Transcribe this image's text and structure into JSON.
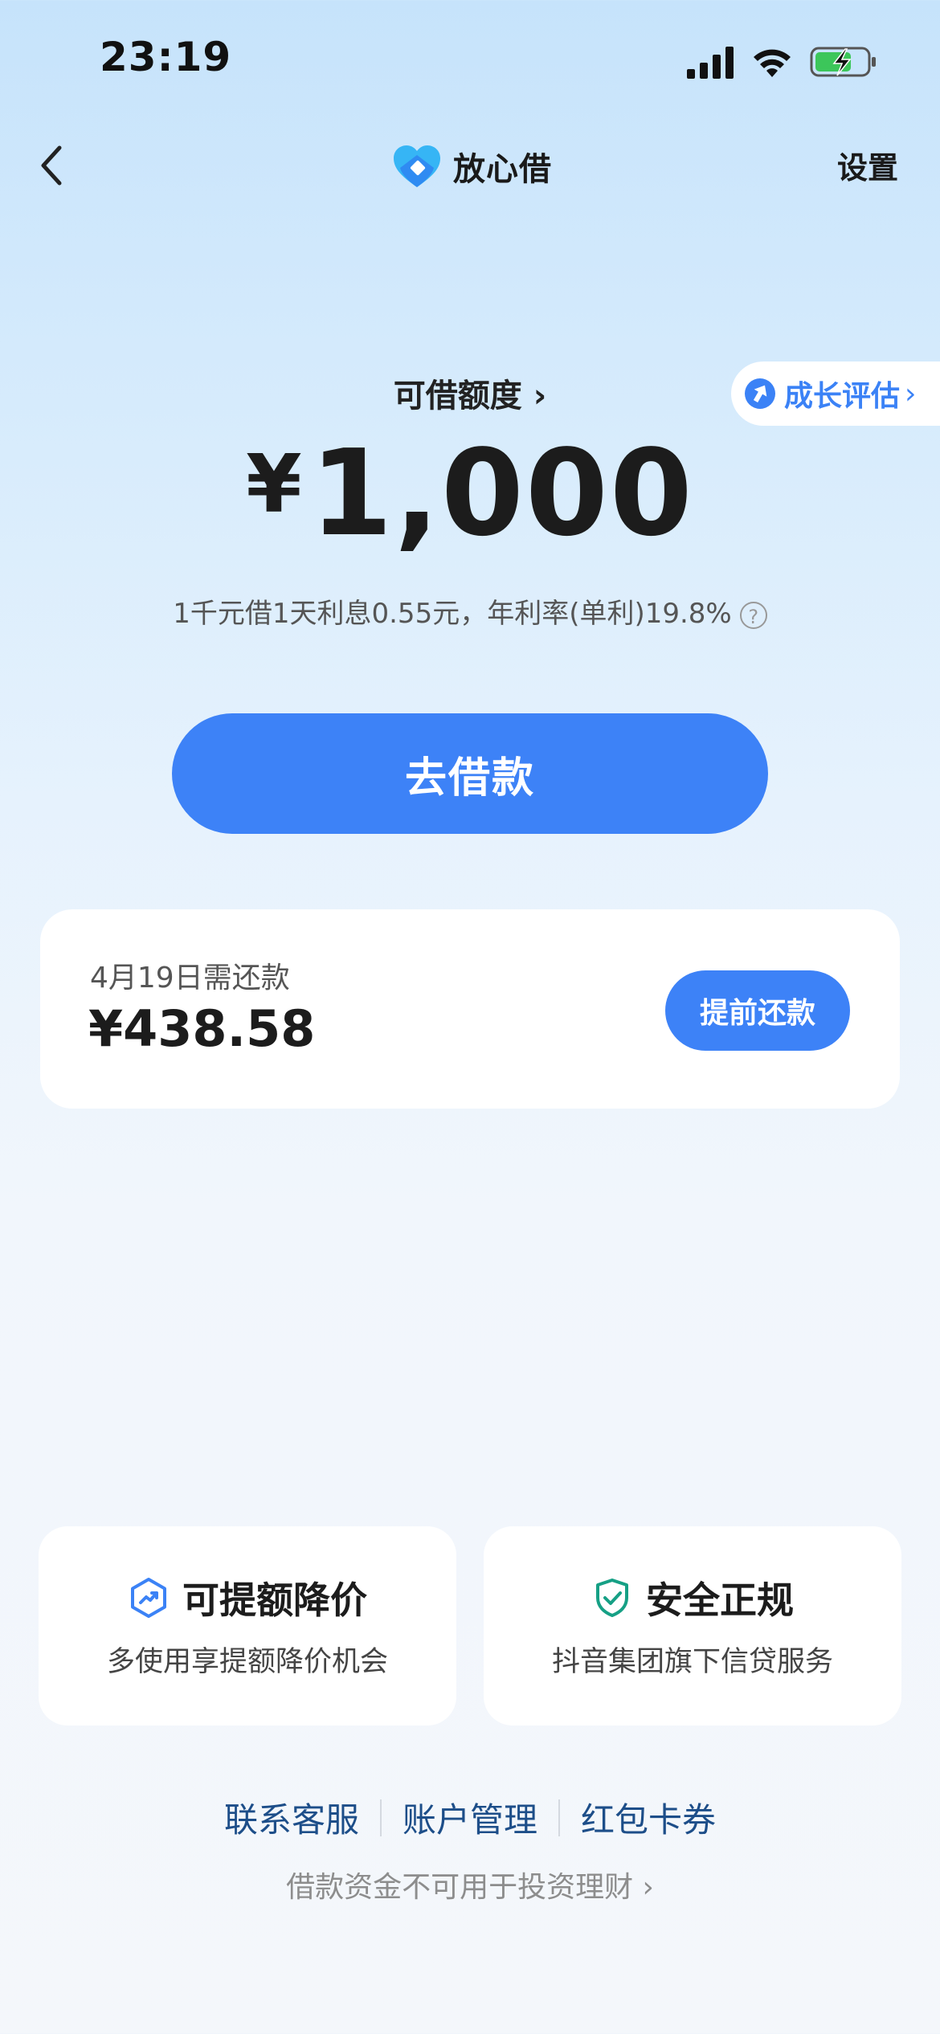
{
  "status_bar": {
    "time": "23:19"
  },
  "nav": {
    "brand_name": "放心借",
    "settings_label": "设置"
  },
  "growth": {
    "label": "成长评估",
    "chevron": "›"
  },
  "credit": {
    "label": "可借额度 ›",
    "currency": "¥",
    "amount": "1,000",
    "rate_text": "1千元借1天利息0.55元，年利率(单利)19.8%",
    "help_glyph": "?"
  },
  "borrow_button": {
    "label": "去借款"
  },
  "repayment": {
    "due_text": "4月19日需还款",
    "amount": "¥438.58",
    "prepay_label": "提前还款"
  },
  "features": [
    {
      "title": "可提额降价",
      "subtitle": "多使用享提额降价机会",
      "icon": "trend-up-hexagon-icon"
    },
    {
      "title": "安全正规",
      "subtitle": "抖音集团旗下信贷服务",
      "icon": "shield-check-icon"
    }
  ],
  "footer": {
    "links": [
      "联系客服",
      "账户管理",
      "红包卡券"
    ],
    "disclaimer": "借款资金不可用于投资理财 ›"
  },
  "colors": {
    "primary": "#3d82f7",
    "link": "#1d4e89",
    "feature_icon_blue": "#3b82f6",
    "feature_icon_green": "#16a085"
  }
}
